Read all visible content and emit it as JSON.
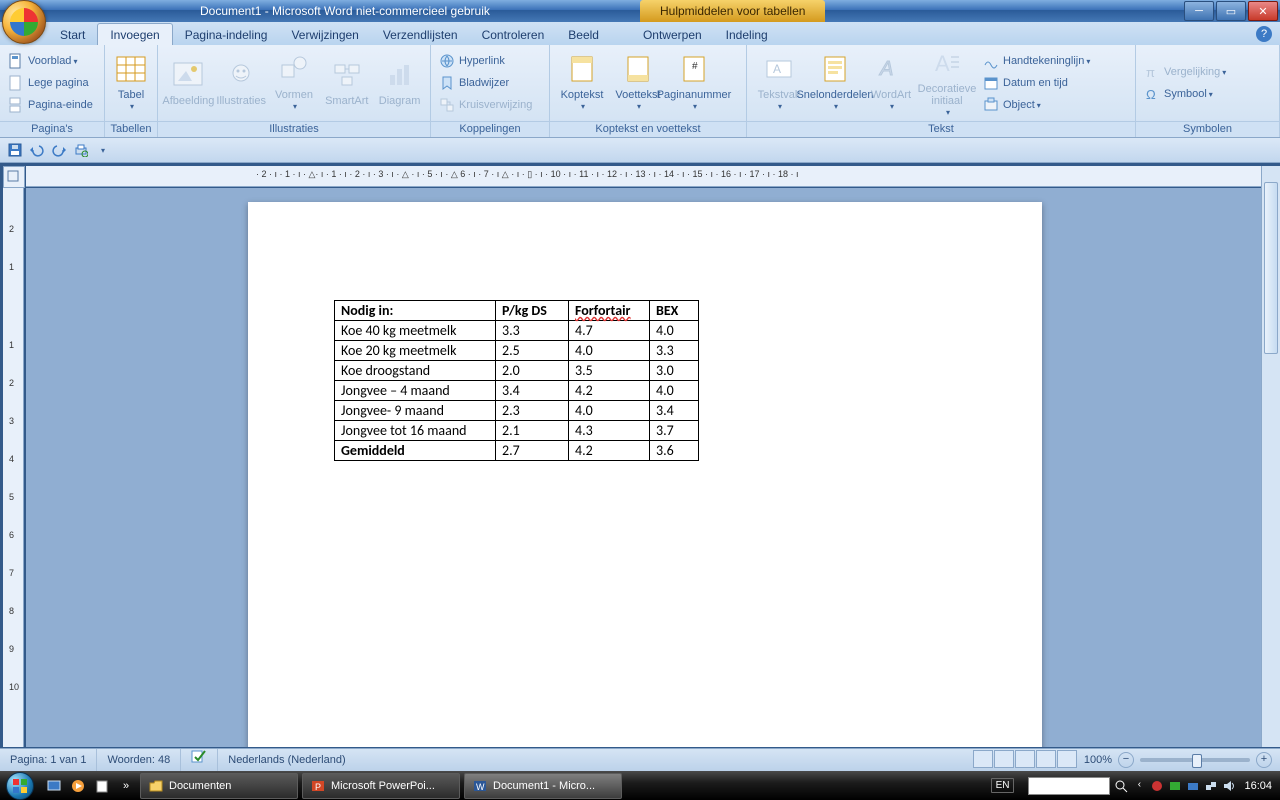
{
  "window": {
    "title": "Document1 - Microsoft Word niet-commercieel gebruik",
    "context_tools": "Hulpmiddelen voor tabellen"
  },
  "tabs": {
    "start": "Start",
    "invoegen": "Invoegen",
    "pagina_indeling": "Pagina-indeling",
    "verwijzingen": "Verwijzingen",
    "verzendlijsten": "Verzendlijsten",
    "controleren": "Controleren",
    "beeld": "Beeld",
    "ontwerpen": "Ontwerpen",
    "indeling": "Indeling"
  },
  "ribbon": {
    "groups": {
      "paginas": "Pagina's",
      "tabellen": "Tabellen",
      "illustraties": "Illustraties",
      "koppelingen": "Koppelingen",
      "koptekst": "Koptekst en voettekst",
      "tekst": "Tekst",
      "symbolen": "Symbolen"
    },
    "paginas": {
      "voorblad": "Voorblad",
      "lege_pagina": "Lege pagina",
      "pagina_einde": "Pagina-einde"
    },
    "tabellen": {
      "tabel": "Tabel"
    },
    "illustraties": {
      "afbeelding": "Afbeelding",
      "illustraties": "Illustraties",
      "vormen": "Vormen",
      "smartart": "SmartArt",
      "diagram": "Diagram"
    },
    "koppelingen": {
      "hyperlink": "Hyperlink",
      "bladwijzer": "Bladwijzer",
      "kruisverwijzing": "Kruisverwijzing"
    },
    "koptekst": {
      "koptekst": "Koptekst",
      "voettekst": "Voettekst",
      "paginanummer": "Paginanummer"
    },
    "tekst": {
      "tekstvak": "Tekstvak",
      "snelonderdelen": "Snelonderdelen",
      "wordart": "WordArt",
      "decoratieve": "Decoratieve initiaal",
      "handtekening": "Handtekeninglijn",
      "datum": "Datum en tijd",
      "object": "Object"
    },
    "symbolen": {
      "vergelijking": "Vergelijking",
      "symbool": "Symbool"
    }
  },
  "ruler": {
    "h": "· 2 · ı · 1 · ı · △· ı · 1 · ı · 2 · ı · 3 · ı · △ · ı · 5 · ı · △ 6 · ı · 7 · ı △ · ı · ▯ · ı · 10 · ı · 11 · ı · 12 · ı · 13 · ı · 14 · ı · 15 · ı · 16 · ı · 17 · ı · 18 · ı"
  },
  "doc_table": {
    "headers": [
      "Nodig in:",
      "P/kg DS",
      "Forfortair",
      "BEX"
    ],
    "rows": [
      [
        "Koe 40 kg meetmelk",
        "3.3",
        "4.7",
        "4.0"
      ],
      [
        "Koe 20 kg meetmelk",
        "2.5",
        "4.0",
        "3.3"
      ],
      [
        "Koe droogstand",
        "2.0",
        "3.5",
        "3.0"
      ],
      [
        "Jongvee – 4 maand",
        "3.4",
        "4.2",
        "4.0"
      ],
      [
        "Jongvee- 9 maand",
        "2.3",
        "4.0",
        "3.4"
      ],
      [
        "Jongvee tot 16 maand",
        "2.1",
        "4.3",
        "3.7"
      ],
      [
        "Gemiddeld",
        "2.7",
        "4.2",
        "3.6"
      ]
    ]
  },
  "status": {
    "page": "Pagina: 1 van 1",
    "words": "Woorden: 48",
    "lang": "Nederlands (Nederland)",
    "zoom": "100%"
  },
  "taskbar": {
    "documenten": "Documenten",
    "powerpoint": "Microsoft PowerPoi...",
    "word": "Document1 - Micro...",
    "input_lang": "EN",
    "clock": "16:04"
  }
}
